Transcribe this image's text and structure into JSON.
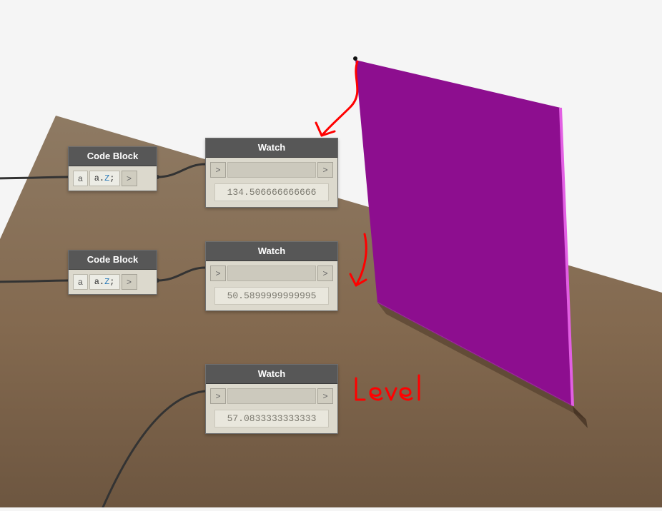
{
  "codeblock1": {
    "title": "Code Block",
    "input_label": "a",
    "code_a": "a",
    "code_dot": ".",
    "code_z": "Z",
    "code_semi": ";",
    "chev": ">"
  },
  "codeblock2": {
    "title": "Code Block",
    "input_label": "a",
    "code_a": "a",
    "code_dot": ".",
    "code_z": "Z",
    "code_semi": ";",
    "chev": ">"
  },
  "watch1": {
    "title": "Watch",
    "chev_in": ">",
    "chev_out": ">",
    "value": "134.506666666666"
  },
  "watch2": {
    "title": "Watch",
    "chev_in": ">",
    "chev_out": ">",
    "value": "50.5899999999995"
  },
  "watch3": {
    "title": "Watch",
    "chev_in": ">",
    "chev_out": ">",
    "value": "57.0833333333333"
  },
  "annotation": {
    "level_text": "Level"
  },
  "colors": {
    "ground_light": "#8e755b",
    "ground_dark": "#6f5a44",
    "wall": "#8d0e8f",
    "wall_edge": "#e25fe3",
    "annot_red": "#ff0000"
  }
}
